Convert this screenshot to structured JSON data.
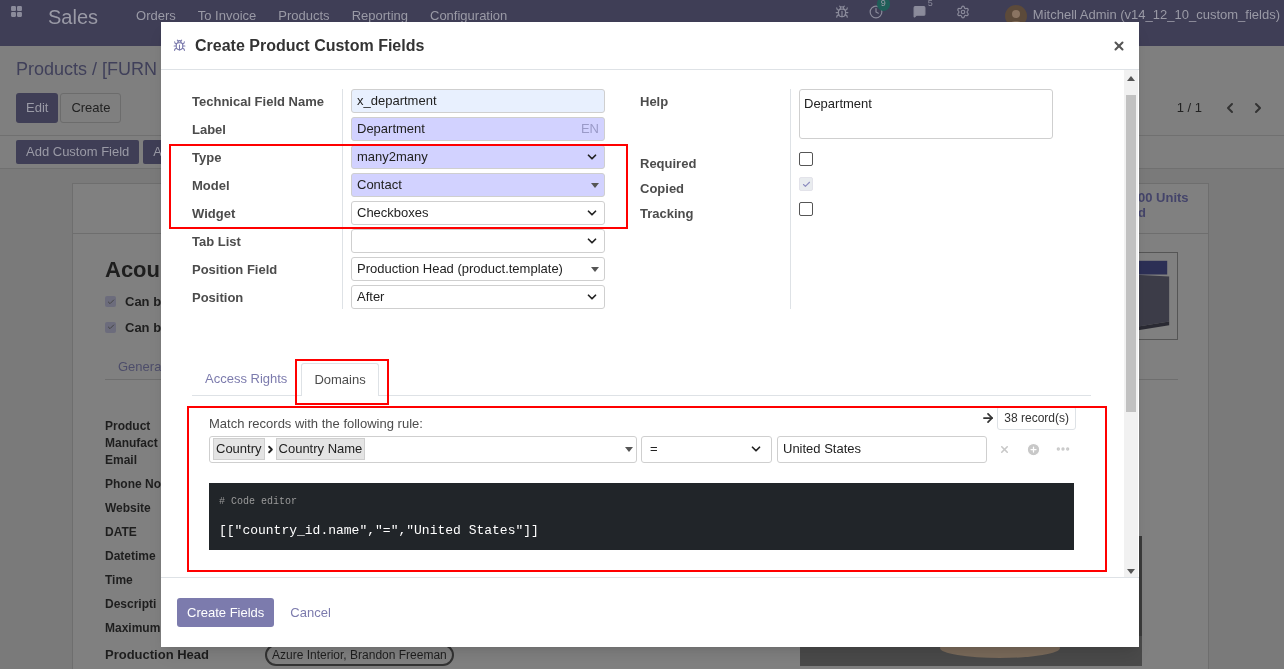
{
  "navbar": {
    "app": "Sales",
    "menu": [
      "Orders",
      "To Invoice",
      "Products",
      "Reporting",
      "Configuration"
    ],
    "activity_count": "9",
    "message_count": "5",
    "user": "Mitchell Admin (v14_12_10_custom_fields)"
  },
  "control_panel": {
    "breadcrumb": "Products / [FURN",
    "buttons": [
      {
        "label": "Edit",
        "kind": "primary"
      },
      {
        "label": "Create",
        "kind": "secondary"
      }
    ],
    "pager": "1 / 1",
    "custom_buttons": [
      "Add Custom Field",
      "A"
    ]
  },
  "record": {
    "stat": [
      "00 Units",
      "d"
    ],
    "title": "Acou",
    "checkboxes": [
      {
        "label": "Can b",
        "checked": true
      },
      {
        "label": "Can b",
        "checked": true
      }
    ],
    "tab": "Genera",
    "fields": [
      "Product Manufact Email",
      "Phone No",
      "Website",
      "DATE",
      "Datetime",
      "Time",
      "Descripti",
      "Maximum"
    ],
    "last_field": {
      "label": "Production Head",
      "value": "Azure Interior, Brandon Freeman"
    }
  },
  "dialog": {
    "title": "Create Product Custom Fields",
    "left_fields": [
      {
        "label": "Technical Field Name",
        "kind": "input",
        "required": false,
        "autofilled": true,
        "value": "x_department"
      },
      {
        "label": "Label",
        "kind": "input",
        "required": true,
        "autofilled": false,
        "value": "Department",
        "lang": "EN"
      },
      {
        "label": "Type",
        "kind": "select",
        "required": true,
        "autofilled": false,
        "value": "many2many"
      },
      {
        "label": "Model",
        "kind": "many2one",
        "required": true,
        "autofilled": false,
        "value": "Contact"
      },
      {
        "label": "Widget",
        "kind": "select",
        "required": false,
        "autofilled": false,
        "value": "Checkboxes"
      },
      {
        "label": "Tab List",
        "kind": "select",
        "required": false,
        "autofilled": false
      },
      {
        "label": "Position Field",
        "kind": "many2one",
        "required": false,
        "autofilled": false,
        "value": "Production Head (product.template)"
      },
      {
        "label": "Position",
        "kind": "select",
        "required": false,
        "autofilled": false,
        "value": "After"
      }
    ],
    "help": {
      "label": "Help",
      "value": "Department"
    },
    "flags": [
      {
        "label": "Required",
        "checked": false,
        "disabled": false
      },
      {
        "label": "Copied",
        "checked": true,
        "disabled": true
      },
      {
        "label": "Tracking",
        "checked": false,
        "disabled": false
      }
    ],
    "tabs": [
      {
        "label": "Access Rights",
        "selected": false
      },
      {
        "label": "Domains",
        "selected": true
      }
    ],
    "domain": {
      "intro": "Match records with the following rule:",
      "record_count": "38 record(s)",
      "path": [
        "Country",
        "Country Name"
      ],
      "operator": "=",
      "value": "United States",
      "code_comment": "# Code editor",
      "code": "[[\"country_id.name\",\"=\",\"United States\"]]"
    },
    "buttons": [
      {
        "label": "Create Fields",
        "kind": "primary"
      },
      {
        "label": "Cancel",
        "kind": "link"
      }
    ]
  }
}
